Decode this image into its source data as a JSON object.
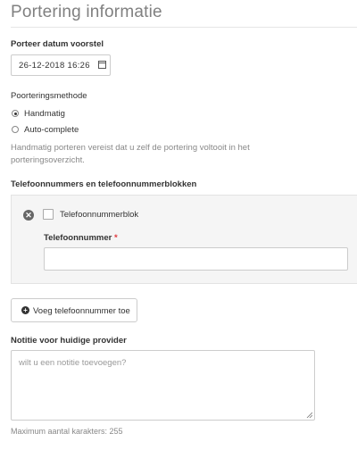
{
  "page": {
    "title": "Portering informatie"
  },
  "date": {
    "label": "Porteer datum voorstel",
    "value": "26-12-2018 16:26"
  },
  "method": {
    "label": "Poorteringsmethode",
    "options": [
      {
        "label": "Handmatig",
        "selected": true
      },
      {
        "label": "Auto-complete",
        "selected": false
      }
    ],
    "help_text": "Handmatig porteren vereist dat u zelf de portering voltooit in het porteringsoverzicht."
  },
  "numbers": {
    "label": "Telefoonnummers en telefoonnummerblokken",
    "block_checkbox_label": "Telefoonnummerblok",
    "block_checked": false,
    "phone_label": "Telefoonnummer",
    "required_marker": "*",
    "phone_value": "",
    "add_button_label": "Voeg telefoonnummer toe"
  },
  "note": {
    "label": "Notitie voor huidige provider",
    "placeholder": "wilt u een notitie toevoegen?",
    "max_chars_text": "Maximum aantal karakters: 255"
  },
  "icons": {
    "remove": "remove-circle-icon",
    "calendar": "calendar-icon",
    "add": "plus-circle-icon",
    "resize": "resize-handle-icon"
  },
  "colors": {
    "required": "#e0393e",
    "panel_bg": "#f5f5f5",
    "title": "#808080"
  }
}
